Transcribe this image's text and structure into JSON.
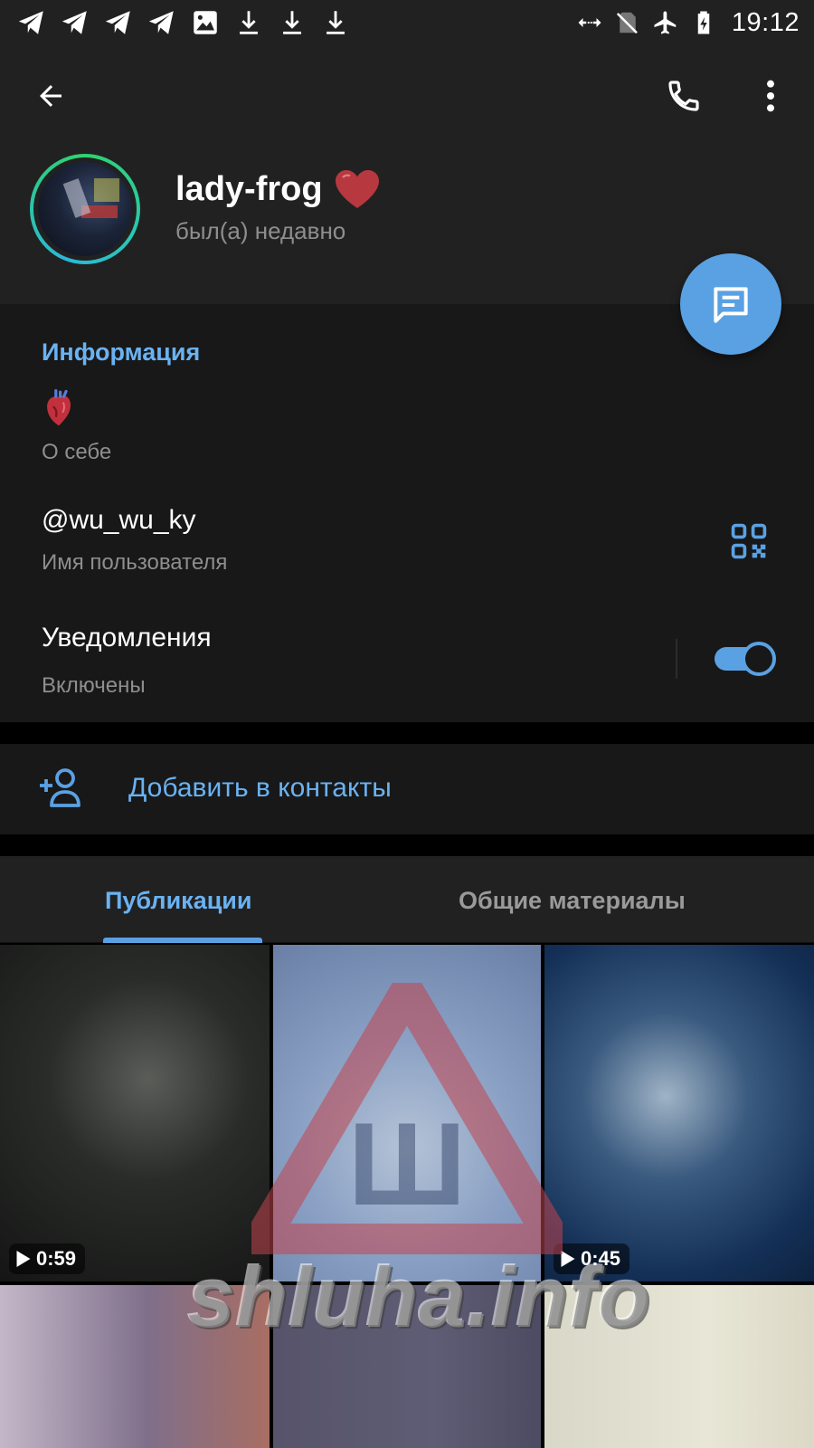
{
  "status_bar": {
    "time": "19:12",
    "left_icons": [
      "telegram-icon",
      "telegram-icon",
      "telegram-icon",
      "telegram-icon",
      "image-icon",
      "download-icon",
      "download-icon",
      "download-icon"
    ],
    "right_icons": [
      "data-saver-icon",
      "no-sim-icon",
      "airplane-icon",
      "battery-charging-icon"
    ]
  },
  "header": {
    "name": "lady-frog",
    "status": "был(а) недавно",
    "icons": {
      "back": "arrow-left-icon",
      "call": "phone-icon",
      "more": "more-vertical-icon",
      "message": "message-icon"
    }
  },
  "info": {
    "title": "Информация",
    "bio_emoji": "anatomical-heart-icon",
    "bio_label": "О себе",
    "username": "@wu_wu_ky",
    "username_label": "Имя пользователя",
    "notifications_title": "Уведомления",
    "notifications_status": "Включены",
    "notifications_enabled": true
  },
  "add_contact": {
    "label": "Добавить в контакты"
  },
  "tabs": [
    {
      "label": "Публикации",
      "active": true
    },
    {
      "label": "Общие материалы",
      "active": false
    }
  ],
  "media": [
    {
      "type": "video",
      "duration": "0:59"
    },
    {
      "type": "photo"
    },
    {
      "type": "video",
      "duration": "0:45"
    },
    {
      "type": "photo"
    },
    {
      "type": "photo"
    },
    {
      "type": "photo"
    }
  ],
  "watermark": {
    "text": "shluha.info",
    "sign_letter": "Ш"
  },
  "colors": {
    "accent": "#5aa1e3",
    "link": "#6ab2f2",
    "background": "#181818",
    "header": "#212121"
  }
}
